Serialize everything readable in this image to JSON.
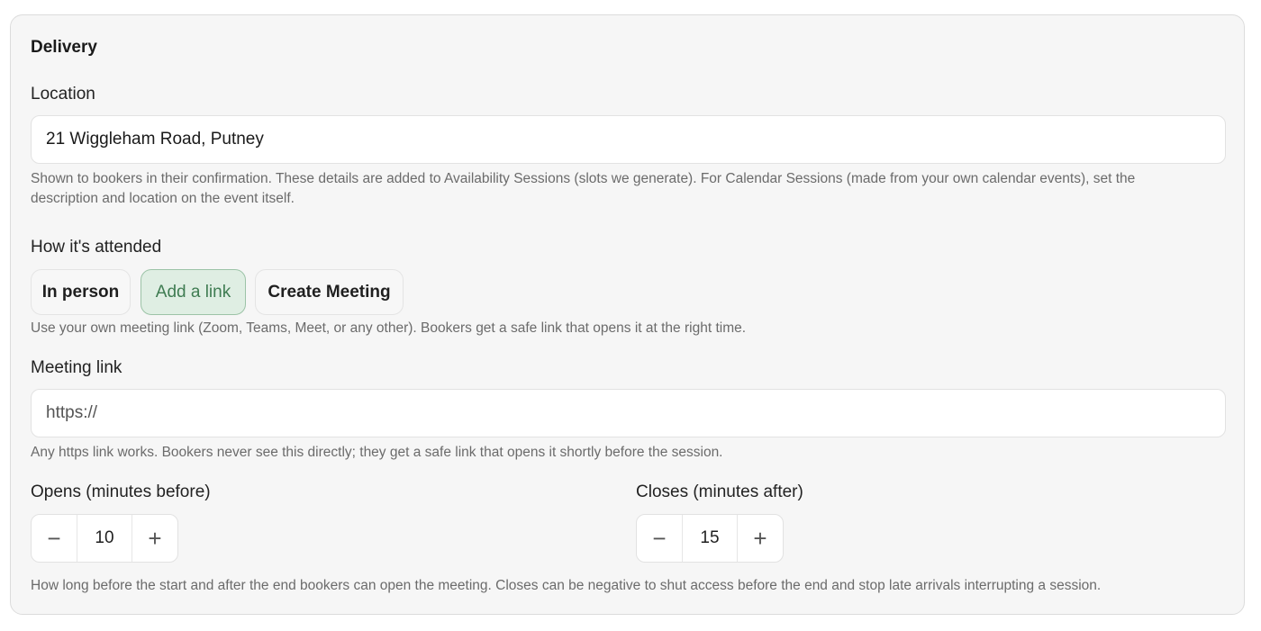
{
  "delivery": {
    "title": "Delivery",
    "location": {
      "label": "Location",
      "value": "21 Wiggleham Road, Putney",
      "help": "Shown to bookers in their confirmation. These details are added to Availability Sessions (slots we generate). For Calendar Sessions (made from your own calendar events), set the description and location on the event itself."
    },
    "attendance": {
      "label": "How it's attended",
      "options": [
        "In person",
        "Add a link",
        "Create Meeting"
      ],
      "selected": "Add a link",
      "help": "Use your own meeting link (Zoom, Teams, Meet, or any other). Bookers get a safe link that opens it at the right time."
    },
    "meeting_link": {
      "label": "Meeting link",
      "placeholder": "https://",
      "value": "",
      "help": "Any https link works. Bookers never see this directly; they get a safe link that opens it shortly before the session."
    },
    "opens": {
      "label": "Opens (minutes before)",
      "value": "10",
      "minus": "−",
      "plus": "+"
    },
    "closes": {
      "label": "Closes (minutes after)",
      "value": "15",
      "minus": "−",
      "plus": "+"
    },
    "timing_help": "How long before the start and after the end bookers can open the meeting. Closes can be negative to shut access before the end and stop late arrivals interrupting a session."
  }
}
